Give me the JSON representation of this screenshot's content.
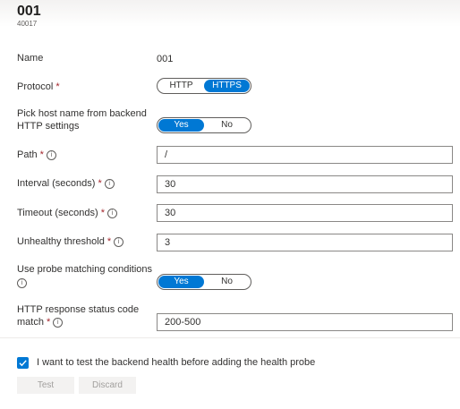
{
  "header": {
    "title": "001",
    "subtitle": "40017"
  },
  "fields": {
    "name": {
      "label": "Name",
      "value": "001"
    },
    "protocol": {
      "label": "Protocol",
      "required": "*",
      "options": [
        "HTTP",
        "HTTPS"
      ],
      "selected": "HTTPS"
    },
    "pick_host": {
      "label_line1": "Pick host name from backend",
      "label_line2": "HTTP settings",
      "options": [
        "Yes",
        "No"
      ],
      "selected": "Yes"
    },
    "path": {
      "label": "Path",
      "required": "*",
      "value": "/"
    },
    "interval": {
      "label": "Interval (seconds)",
      "required": "*",
      "value": "30"
    },
    "timeout": {
      "label": "Timeout (seconds)",
      "required": "*",
      "value": "30"
    },
    "unhealthy": {
      "label": "Unhealthy threshold",
      "required": "*",
      "value": "3"
    },
    "probe_matching": {
      "label": "Use probe matching conditions",
      "options": [
        "Yes",
        "No"
      ],
      "selected": "Yes"
    },
    "status_code": {
      "label_line1": "HTTP response status code",
      "label_line2": "match",
      "required": "*",
      "value": "200-500"
    }
  },
  "info_glyph": "i",
  "test_checkbox": {
    "checked": true,
    "label": "I want to test the backend health before adding the health probe"
  },
  "buttons": {
    "test": "Test",
    "discard": "Discard"
  },
  "colors": {
    "accent": "#0078d4",
    "required": "#a4262c",
    "text": "#323130"
  }
}
